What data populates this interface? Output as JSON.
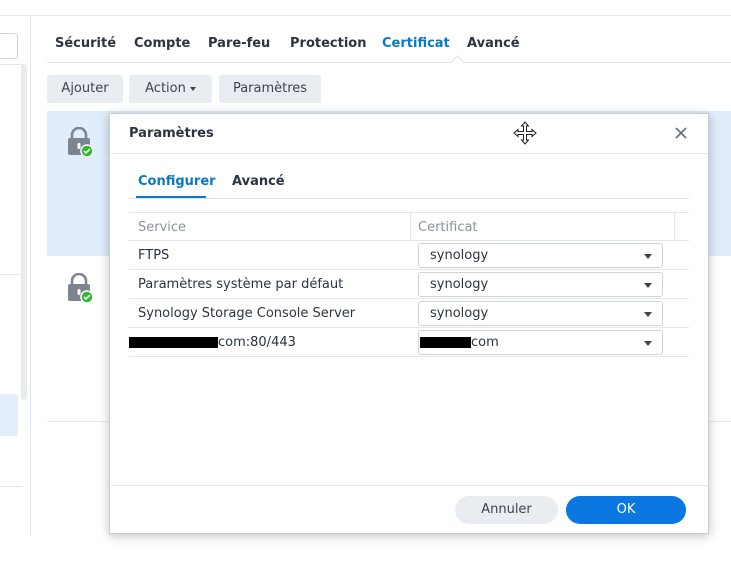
{
  "main": {
    "tabs": [
      {
        "label": "Sécurité"
      },
      {
        "label": "Compte"
      },
      {
        "label": "Pare-feu"
      },
      {
        "label": "Protection"
      },
      {
        "label": "Certificat"
      },
      {
        "label": "Avancé"
      }
    ],
    "active_tab": "Certificat",
    "toolbar": {
      "add_label": "Ajouter",
      "action_label": "Action",
      "settings_label": "Paramètres"
    }
  },
  "dialog": {
    "title": "Paramètres",
    "tabs": [
      {
        "label": "Configurer"
      },
      {
        "label": "Avancé"
      }
    ],
    "active_tab": "Configurer",
    "columns": {
      "service": "Service",
      "certificate": "Certificat"
    },
    "rows": [
      {
        "service": "FTPS",
        "certificate": "synology"
      },
      {
        "service": "Paramètres système par défaut",
        "certificate": "synology"
      },
      {
        "service": "Synology Storage Console Server",
        "certificate": "synology"
      },
      {
        "service": "com:80/443",
        "certificate": "com"
      }
    ],
    "cancel_label": "Annuler",
    "ok_label": "OK"
  },
  "colors": {
    "accent": "#0a78c2",
    "primary_button": "#0a78e0",
    "selected_row": "#e1edfb",
    "success_badge": "#2eb82e"
  },
  "icons": [
    "lock-icon",
    "check-badge-icon",
    "move-cursor-icon",
    "close-icon",
    "chevron-down-icon"
  ]
}
